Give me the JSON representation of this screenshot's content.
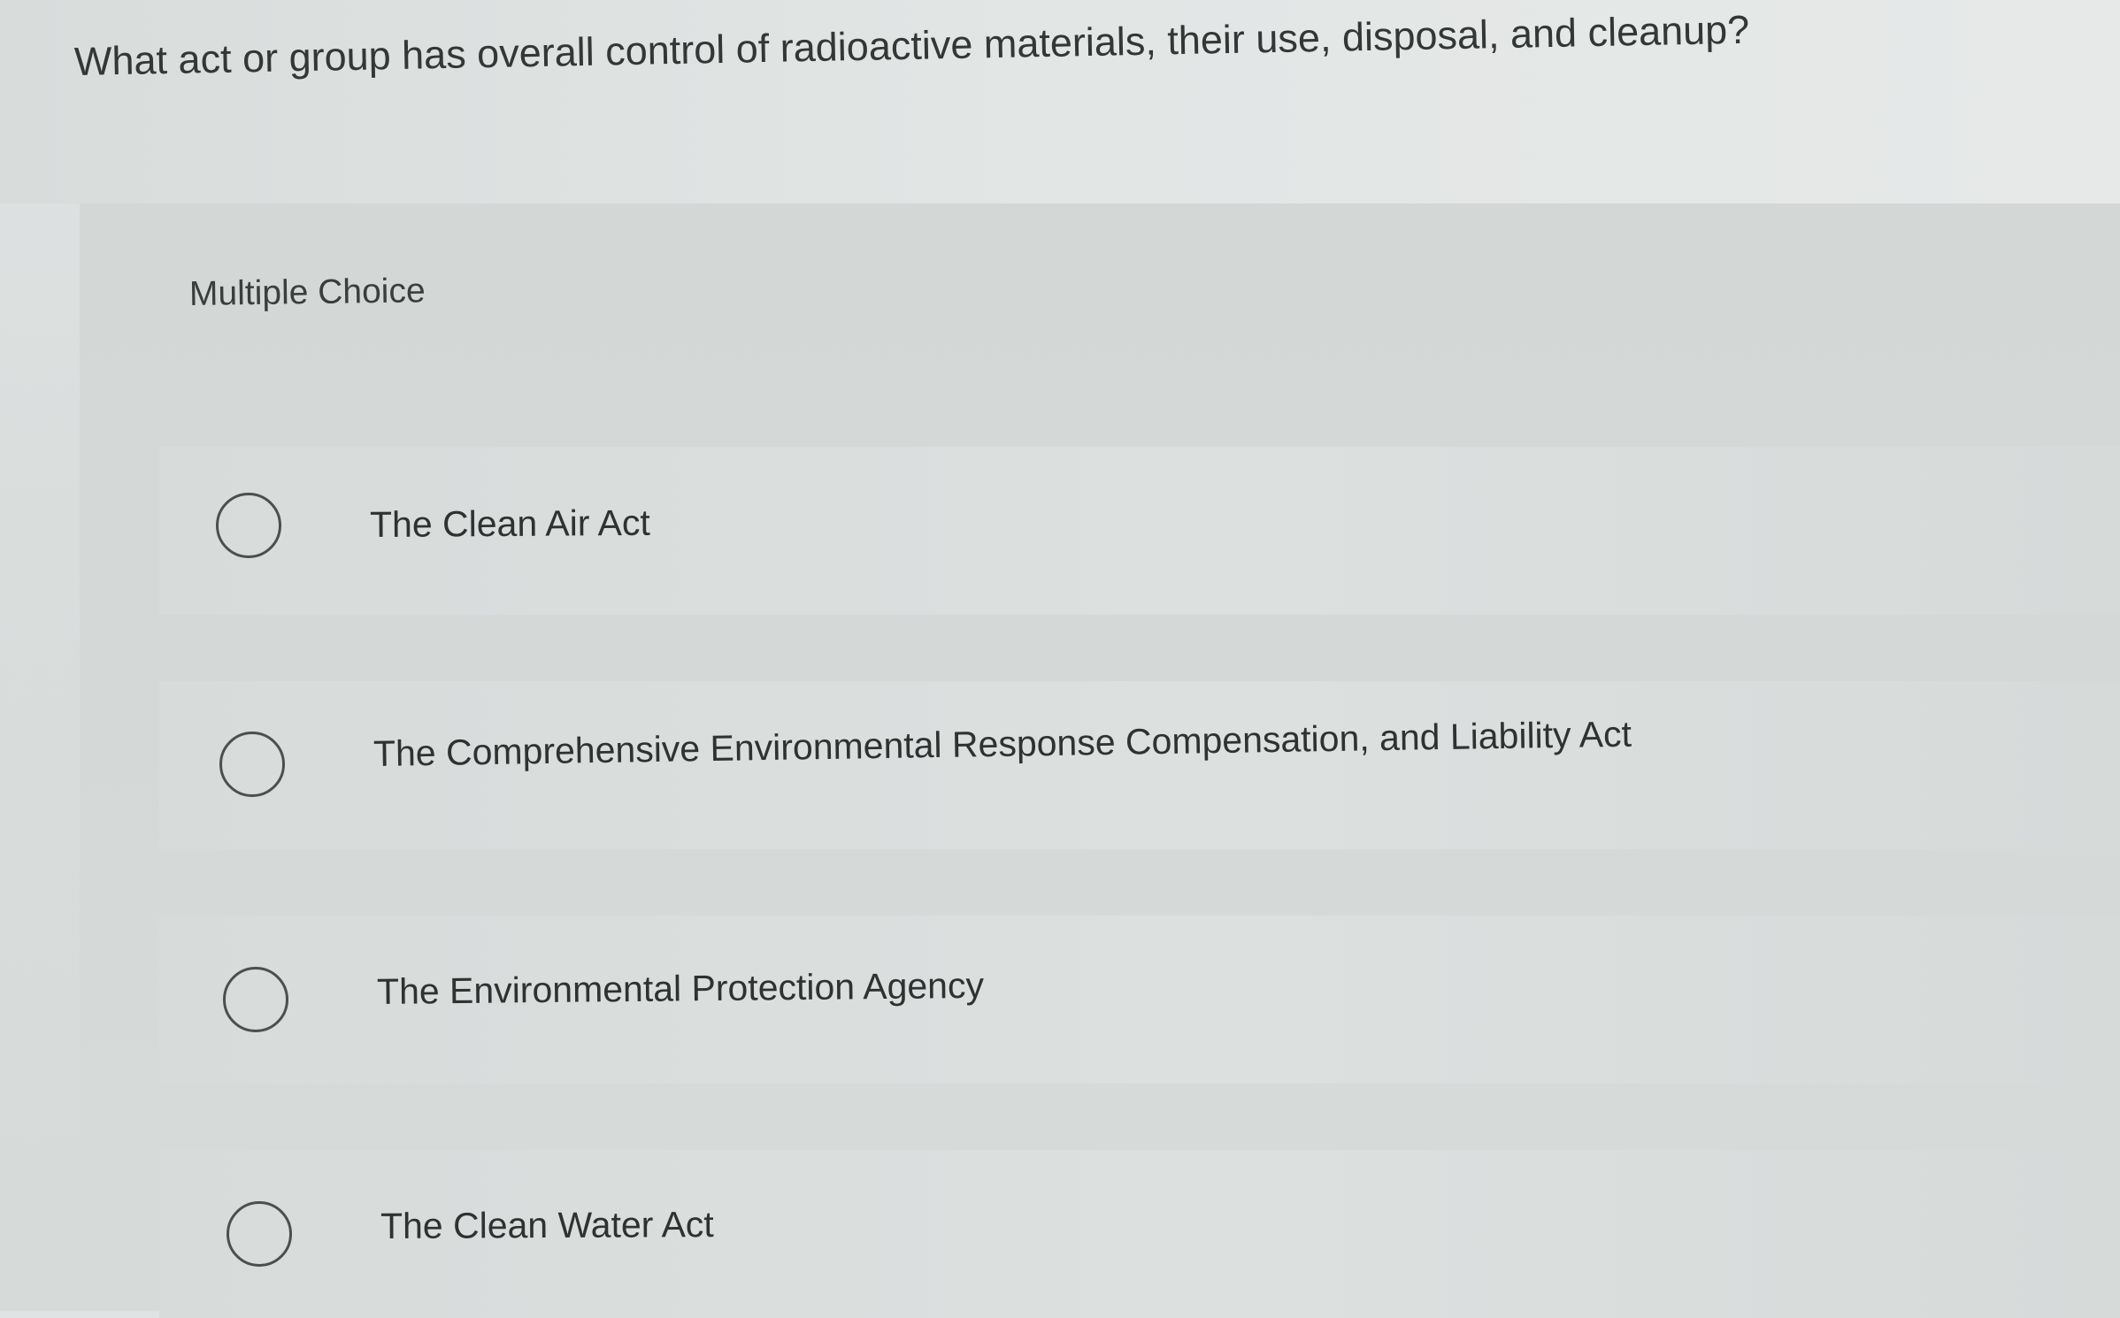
{
  "question": {
    "text": "What act or group has overall control of radioactive materials, their use, disposal, and cleanup?"
  },
  "panel": {
    "label": "Multiple Choice"
  },
  "options": [
    {
      "label": "The Clean Air Act",
      "selected": false
    },
    {
      "label": "The Comprehensive Environmental Response Compensation, and Liability Act",
      "selected": false
    },
    {
      "label": "The Environmental Protection Agency",
      "selected": false
    },
    {
      "label": "The Clean Water Act",
      "selected": false
    }
  ]
}
